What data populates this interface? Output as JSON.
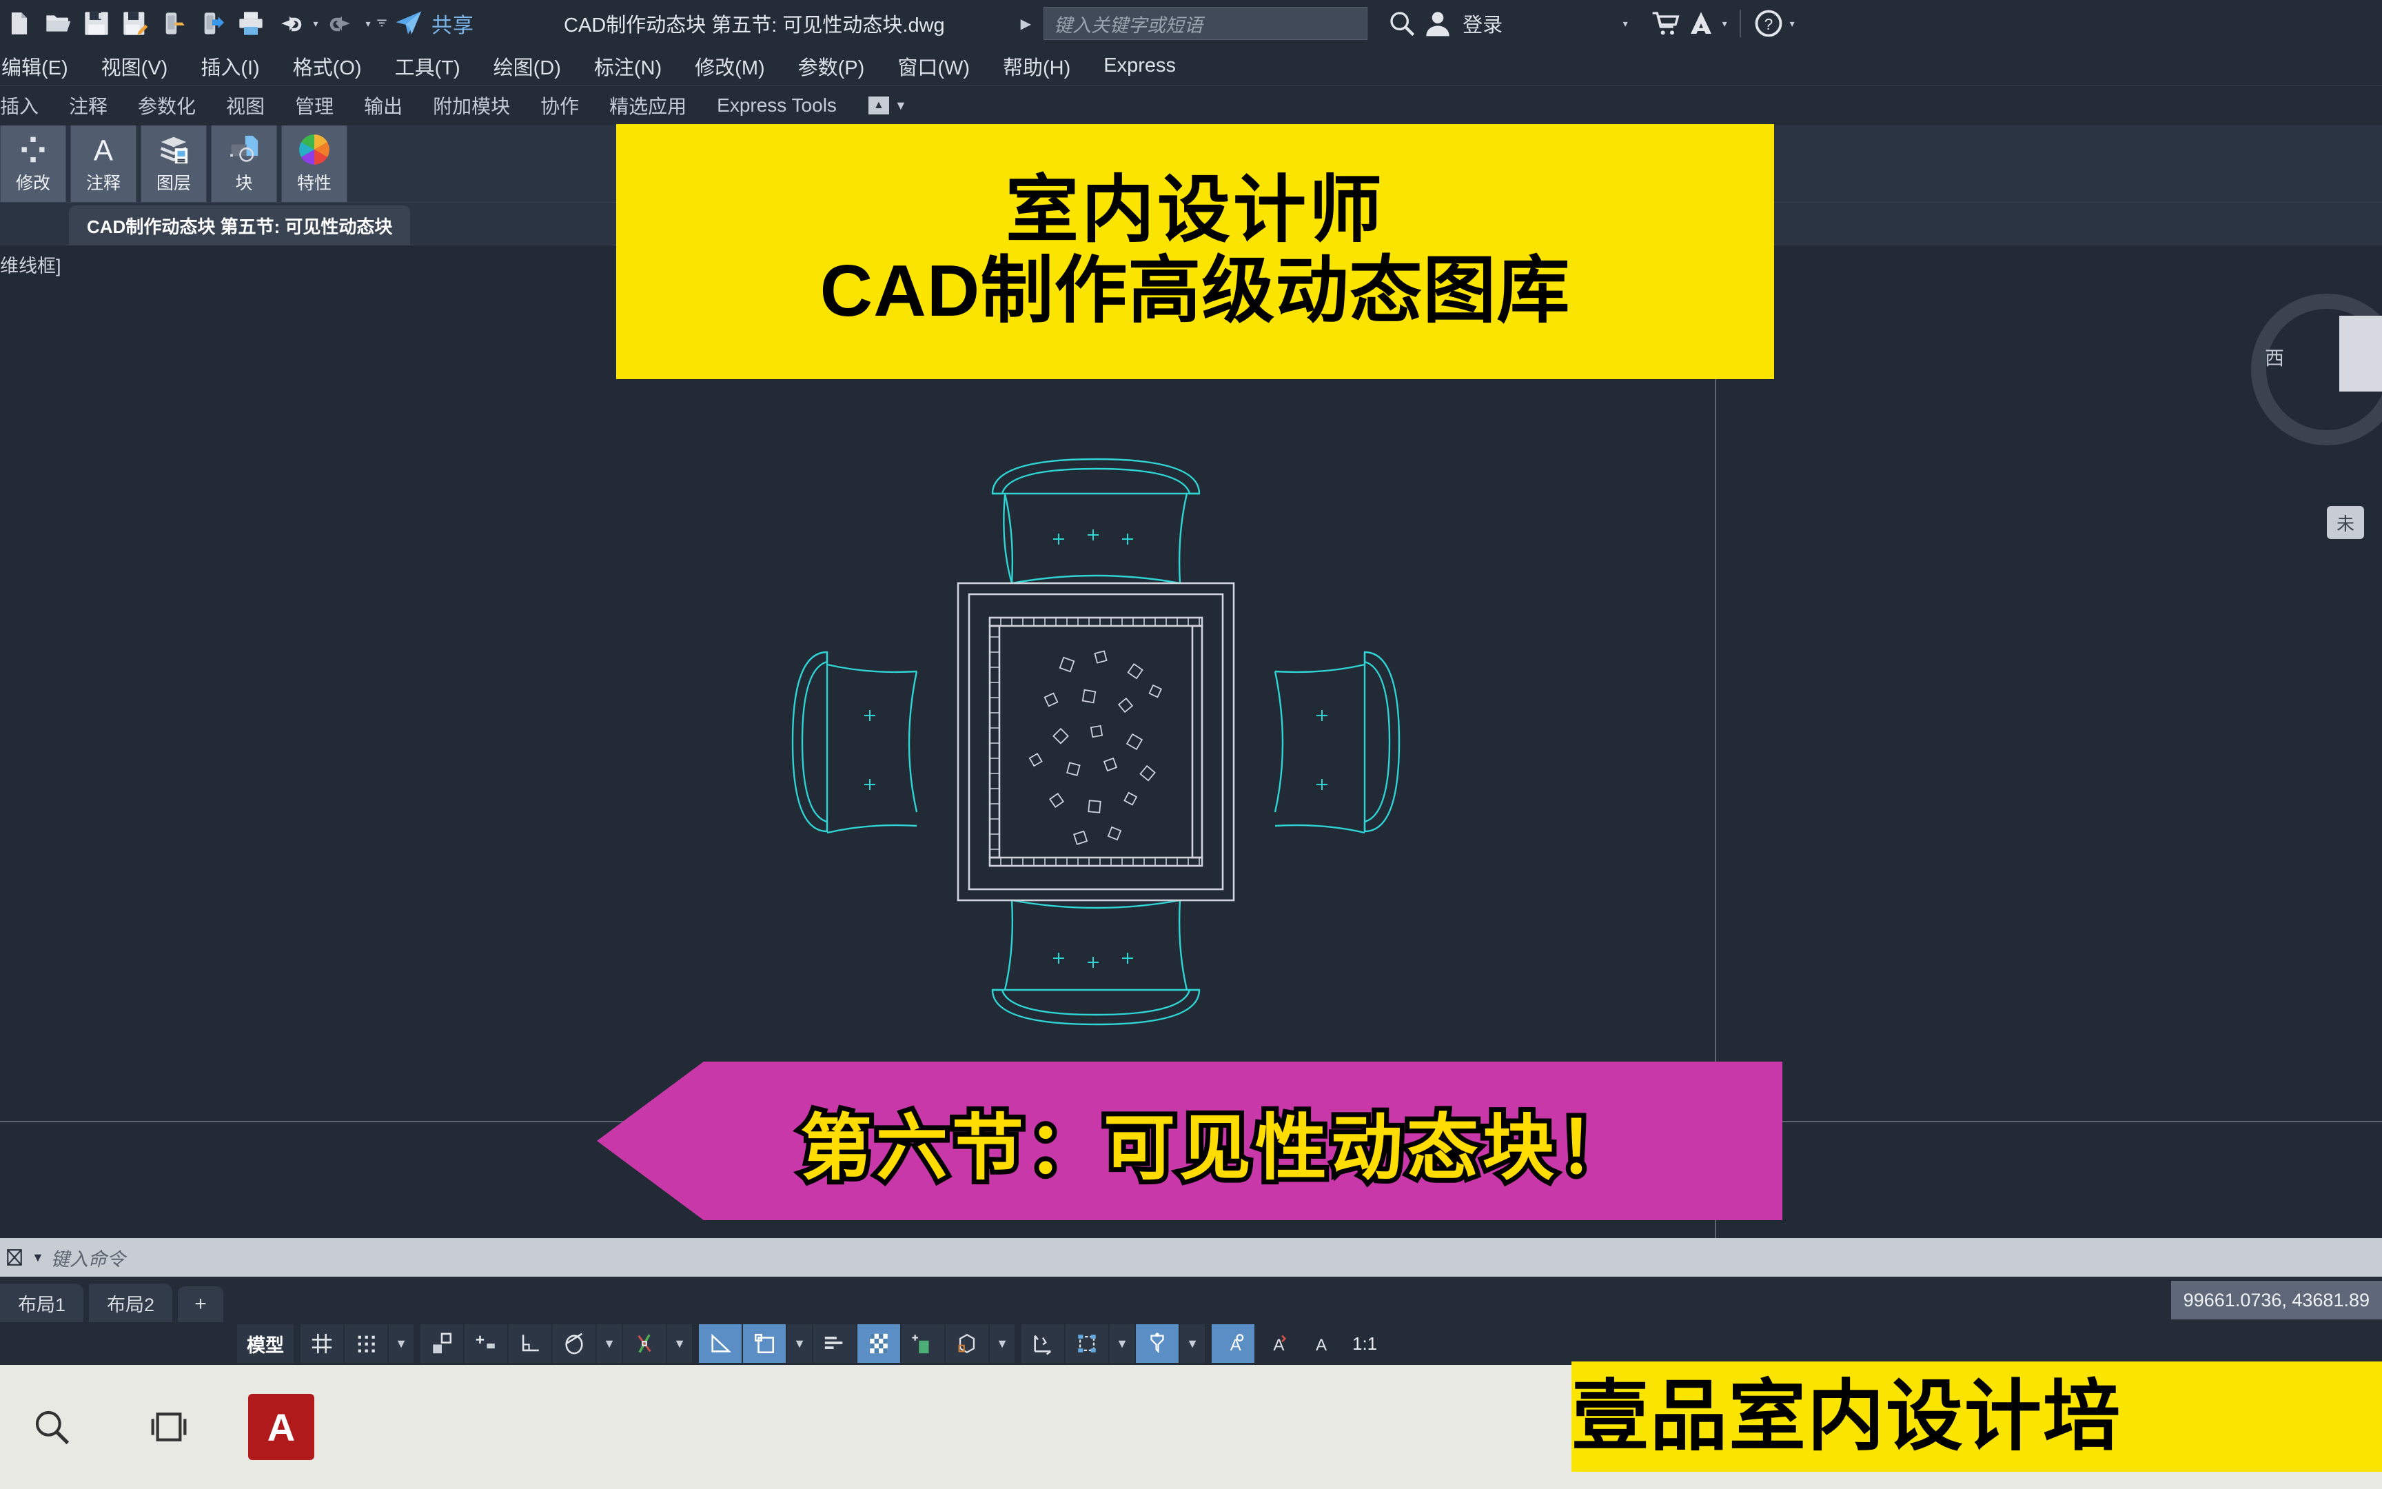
{
  "titlebar": {
    "share_label": "共享",
    "document_title": "CAD制作动态块 第五节: 可见性动态块.dwg",
    "search_placeholder": "键入关键字或短语",
    "signin_label": "登录",
    "quick_access_icons": [
      "new-file-icon",
      "open-folder-icon",
      "save-icon",
      "save-as-icon",
      "export-icon",
      "import-icon",
      "plot-icon",
      "undo-icon",
      "redo-icon",
      "qat-dropdown-icon",
      "share-icon"
    ],
    "right_icons": [
      "search-icon",
      "user-icon",
      "cart-icon",
      "autodesk-icon",
      "help-icon"
    ]
  },
  "menubar": {
    "items": [
      "编辑(E)",
      "视图(V)",
      "插入(I)",
      "格式(O)",
      "工具(T)",
      "绘图(D)",
      "标注(N)",
      "修改(M)",
      "参数(P)",
      "窗口(W)",
      "帮助(H)",
      "Express"
    ]
  },
  "ribbon": {
    "tabs": [
      "插入",
      "注释",
      "参数化",
      "视图",
      "管理",
      "输出",
      "附加模块",
      "协作",
      "精选应用",
      "Express Tools"
    ],
    "minimize_caret": "▼",
    "panels": [
      {
        "label": "修改",
        "icon": "modify-array-icon"
      },
      {
        "label": "注释",
        "icon": "annotation-A-icon"
      },
      {
        "label": "图层",
        "icon": "layers-icon"
      },
      {
        "label": "块",
        "icon": "block-icon"
      },
      {
        "label": "特性",
        "icon": "properties-colorwheel-icon"
      }
    ]
  },
  "doc_tabs": {
    "active_tab": "CAD制作动态块 第五节: 可见性动态块"
  },
  "viewport": {
    "view_label": "维线框]",
    "viewcube_west": "西",
    "viewcube_pill": "未",
    "drawing_name": "cad-table-with-chairs-plan"
  },
  "command_line": {
    "placeholder": "键入命令",
    "icon": "command-history-icon"
  },
  "layout_bar": {
    "tabs": [
      "布局1",
      "布局2"
    ],
    "add_label": "+",
    "coordinates": "99661.0736, 43681.89"
  },
  "status_bar": {
    "model_label": "模型",
    "scale_label": "1:1",
    "toggles": [
      {
        "name": "grid-display-toggle",
        "on": false
      },
      {
        "name": "snap-mode-toggle",
        "on": false
      },
      {
        "name": "snap-dropdown",
        "on": false
      },
      {
        "name": "ortho-mode-toggle",
        "on": false
      },
      {
        "name": "polar-tracking-toggle",
        "on": false
      },
      {
        "name": "object-snap-toggle",
        "on": false
      },
      {
        "name": "osnap-tracking-toggle",
        "on": false
      },
      {
        "name": "osnap-dropdown",
        "on": false
      },
      {
        "name": "lineweight-toggle",
        "on": false
      },
      {
        "name": "lineweight-dropdown",
        "on": false
      },
      {
        "name": "angle-constraint-toggle",
        "on": true
      },
      {
        "name": "dynamic-input-toggle",
        "on": true
      },
      {
        "name": "dyn-dropdown",
        "on": false
      },
      {
        "name": "annotation-visibility-toggle",
        "on": false
      },
      {
        "name": "transparency-toggle",
        "on": true
      },
      {
        "name": "selection-cycling-toggle",
        "on": false
      },
      {
        "name": "3d-object-snap-toggle",
        "on": false
      },
      {
        "name": "3d-dropdown",
        "on": false
      },
      {
        "name": "ucs-icon-toggle",
        "on": false
      },
      {
        "name": "dynamic-ucs-toggle",
        "on": false
      },
      {
        "name": "ucs-dropdown",
        "on": false
      },
      {
        "name": "selection-filter-toggle",
        "on": true
      },
      {
        "name": "filter-dropdown",
        "on": false
      },
      {
        "name": "gizmo-toggle",
        "on": true
      },
      {
        "name": "annotation-monitor-toggle",
        "on": false
      },
      {
        "name": "units-toggle",
        "on": false
      }
    ]
  },
  "taskbar": {
    "icons": [
      "search-icon",
      "task-view-icon",
      "autocad-icon"
    ],
    "autocad_glyph": "A"
  },
  "overlays": {
    "top_banner_line1": "室内设计师",
    "top_banner_line2": "CAD制作高级动态图库",
    "section_banner": "第六节：可见性动态块！",
    "bottom_banner": "壹品室内设计培",
    "colors": {
      "banner_yellow": "#fbe400",
      "banner_magenta": "#c838a8",
      "banner_text_yellow": "#ffdd00",
      "cad_cyan": "#2fd4d4"
    }
  }
}
